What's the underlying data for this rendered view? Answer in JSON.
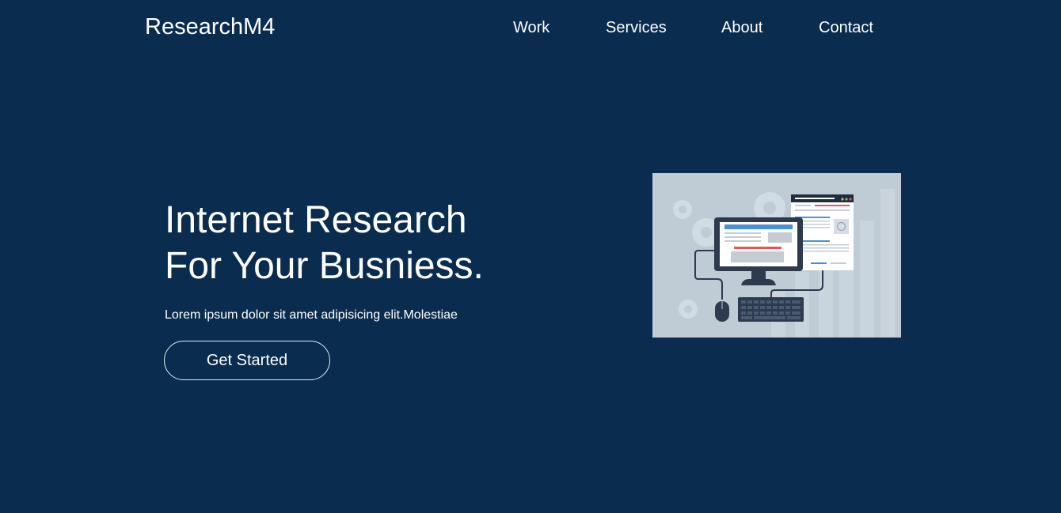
{
  "header": {
    "logo": "ResearchM4",
    "nav": [
      {
        "label": "Work"
      },
      {
        "label": "Services"
      },
      {
        "label": "About"
      },
      {
        "label": "Contact"
      }
    ]
  },
  "hero": {
    "title_line1": "Internet Research",
    "title_line2": "For Your Busniess.",
    "subtitle": "Lorem ipsum dolor sit amet adipisicing elit.Molestiae",
    "cta_label": "Get Started"
  },
  "illustration": {
    "icon": "computer-research-illustration"
  },
  "colors": {
    "background": "#0a2c4f",
    "text": "#ffffff",
    "illustration_bg": "#bfcbd5",
    "monitor_dark": "#2e3a4e",
    "accent_blue": "#4a90d9",
    "accent_red": "#e05a5a"
  }
}
